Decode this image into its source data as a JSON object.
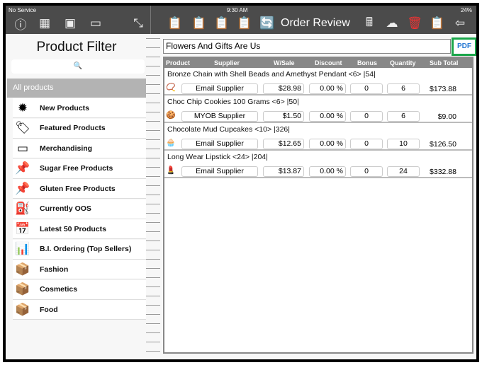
{
  "status": {
    "carrier": "No Service",
    "time": "9:30 AM",
    "battery": "24%"
  },
  "toolbar": {
    "title": "Order Review",
    "left_icons": [
      "info-icon",
      "store-icon",
      "box-icon",
      "presentation-icon",
      "resize-icon"
    ],
    "right_icons": [
      "clipboard-edit-icon",
      "clipboard-add-icon",
      "clipboard-sale-icon",
      "clipboard-calculator-icon",
      "clipboard-sync-icon",
      "calculator-icon",
      "cloud-upload-icon",
      "trash-icon",
      "clipboard-icon",
      "back-arrow-icon"
    ]
  },
  "filter": {
    "title": "Product Filter",
    "search_placeholder": "🔍",
    "all_label": "All products",
    "items": [
      {
        "label": "New Products",
        "icon": "new-badge-icon"
      },
      {
        "label": "Featured Products",
        "icon": "tag-icon"
      },
      {
        "label": "Merchandising",
        "icon": "hanging-sign-icon"
      },
      {
        "label": "Sugar Free Products",
        "icon": "pin-icon"
      },
      {
        "label": "Gluten Free Products",
        "icon": "pin-icon"
      },
      {
        "label": "Currently OOS",
        "icon": "fuel-gauge-icon"
      },
      {
        "label": "Latest 50 Products",
        "icon": "calendar-icon"
      },
      {
        "label": "B.I. Ordering (Top Sellers)",
        "icon": "bar-chart-icon"
      },
      {
        "label": "Fashion",
        "icon": "package-icon"
      },
      {
        "label": "Cosmetics",
        "icon": "package-icon"
      },
      {
        "label": "Food",
        "icon": "package-icon"
      }
    ]
  },
  "order": {
    "supplier_name": "Flowers And Gifts Are Us",
    "pdf_label": "PDF",
    "pdf_highlight": "#1aa64a",
    "columns": [
      "Product",
      "Supplier",
      "W/Sale",
      "Discount",
      "Bonus",
      "Quantity",
      "Sub Total"
    ],
    "rows": [
      {
        "name": "Bronze Chain with Shell Beads and Amethyst Pendant <6> |54|",
        "supplier": "Email Supplier",
        "wsale": "$28.98",
        "discount": "0.00 %",
        "bonus": "0",
        "quantity": "6",
        "subtotal": "$173.88",
        "thumb": "📿"
      },
      {
        "name": "Choc Chip Cookies 100 Grams <6> |50|",
        "supplier": "MYOB Supplier",
        "wsale": "$1.50",
        "discount": "0.00 %",
        "bonus": "0",
        "quantity": "6",
        "subtotal": "$9.00",
        "thumb": "🍪"
      },
      {
        "name": "Chocolate Mud Cupcakes  <10> |326|",
        "supplier": "Email Supplier",
        "wsale": "$12.65",
        "discount": "0.00 %",
        "bonus": "0",
        "quantity": "10",
        "subtotal": "$126.50",
        "thumb": "🧁"
      },
      {
        "name": "Long Wear Lipstick <24> |204|",
        "supplier": "Email Supplier",
        "wsale": "$13.87",
        "discount": "0.00 %",
        "bonus": "0",
        "quantity": "24",
        "subtotal": "$332.88",
        "thumb": "💄"
      }
    ]
  }
}
